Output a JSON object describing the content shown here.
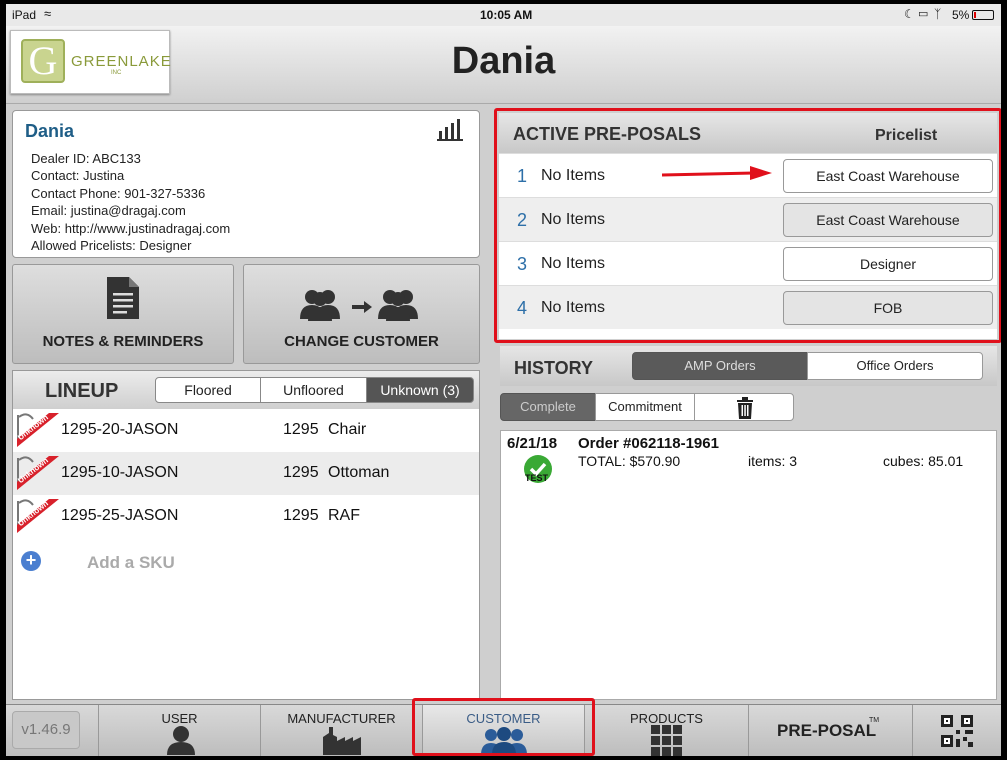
{
  "status": {
    "device": "iPad",
    "time": "10:05 AM",
    "battery": "5%"
  },
  "header": {
    "logo_text": "GREENLAKE",
    "logo_sub": "INC",
    "logo_letter": "G",
    "title": "Dania"
  },
  "customer": {
    "name": "Dania",
    "lines": [
      "Dealer ID: ABC133",
      "Contact: Justina",
      "Contact Phone: 901-327-5336",
      "Email: justina@dragaj.com",
      "Web: http://www.justinadragaj.com",
      "Allowed Pricelists: Designer"
    ]
  },
  "actions": {
    "notes_label": "NOTES & REMINDERS",
    "change_label": "CHANGE CUSTOMER"
  },
  "lineup": {
    "title": "LINEUP",
    "tabs": [
      "Floored",
      "Unfloored",
      "Unknown (3)"
    ],
    "active_tab": "Unknown (3)",
    "ribbon": "Unknown",
    "rows": [
      {
        "sku": "1295-20-JASON",
        "series": "1295",
        "desc": "Chair"
      },
      {
        "sku": "1295-10-JASON",
        "series": "1295",
        "desc": "Ottoman"
      },
      {
        "sku": "1295-25-JASON",
        "series": "1295",
        "desc": "RAF"
      }
    ],
    "add_label": "Add a SKU"
  },
  "preposals": {
    "title": "ACTIVE PRE-POSALS",
    "pricelist_header": "Pricelist",
    "rows": [
      {
        "num": "1",
        "name": "No Items",
        "pricelist": "East Coast Warehouse"
      },
      {
        "num": "2",
        "name": "No Items",
        "pricelist": "East Coast Warehouse"
      },
      {
        "num": "3",
        "name": "No Items",
        "pricelist": "Designer"
      },
      {
        "num": "4",
        "name": "No Items",
        "pricelist": "FOB"
      }
    ]
  },
  "history": {
    "title": "HISTORY",
    "tabs": [
      "AMP Orders",
      "Office Orders"
    ],
    "subtabs": [
      "Complete",
      "Commitment"
    ],
    "order": {
      "date": "6/21/18",
      "number": "Order #062118-1961",
      "total": "TOTAL: $570.90",
      "items": "items: 3",
      "cubes": "cubes: 85.01",
      "badge": "TEST"
    }
  },
  "tabbar": {
    "version": "v1.46.9",
    "tabs": [
      "USER",
      "MANUFACTURER",
      "CUSTOMER",
      "PRODUCTS"
    ],
    "preposal": "PRE-POSAL",
    "tm": "TM"
  },
  "colors": {
    "accent_blue": "#2d6fa8",
    "highlight_red": "#e0101b",
    "check_green": "#3aa935"
  }
}
